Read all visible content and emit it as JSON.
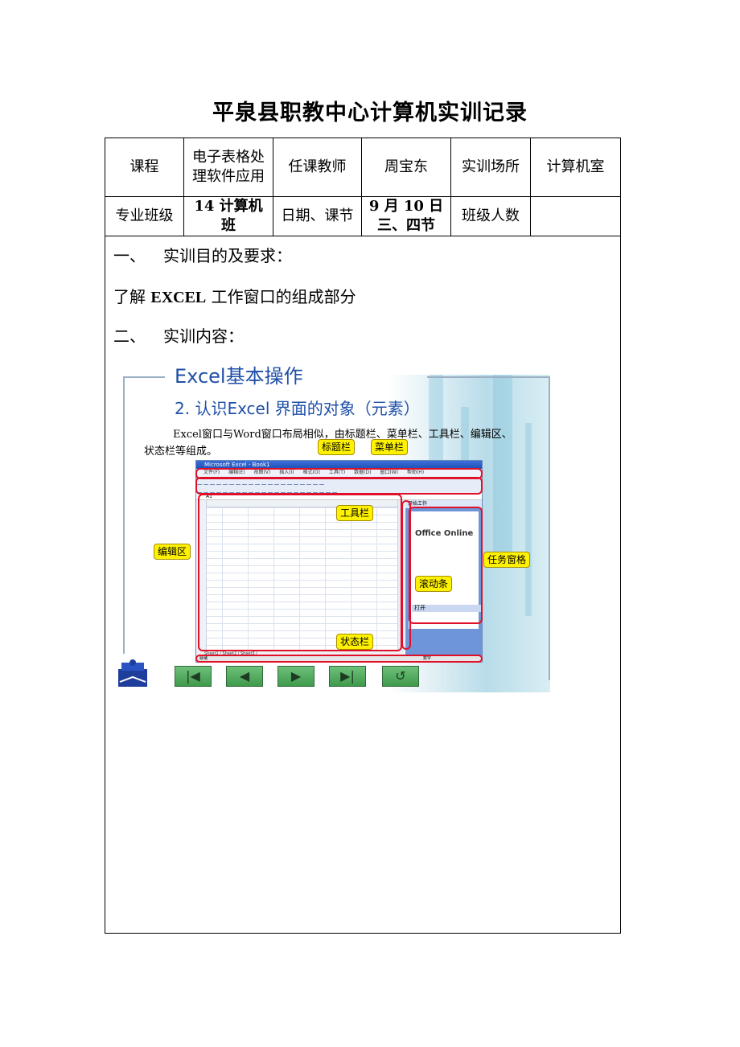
{
  "title": "平泉县职教中心计算机实训记录",
  "table": {
    "row1": [
      "课程",
      "电子表格处理软件应用",
      "任课教师",
      "周宝东",
      "实训场所",
      "计算机室"
    ],
    "row2": [
      "专业班级",
      "14 计算机班",
      "日期、课节",
      "9 月 10 日三、四节",
      "班级人数",
      ""
    ]
  },
  "sections": {
    "s1_num": "一、",
    "s1_title": "实训目的及要求：",
    "goal_prefix": "了解 ",
    "goal_bold": "EXCEL",
    "goal_suffix": " 工作窗口的组成部分",
    "s2_num": "二、",
    "s2_title": "实训内容："
  },
  "slide": {
    "heading": "Excel基本操作",
    "subheading": "2.  认识Excel 界面的对象（元素）",
    "paragraph": "Excel窗口与Word窗口布局相似，由标题栏、菜单栏、工具栏、编辑区、状态栏等组成。",
    "window_title": "Microsoft Excel - Book1",
    "menus": [
      "文件(F)",
      "编辑(E)",
      "视图(V)",
      "插入(I)",
      "格式(O)",
      "工具(T)",
      "数据(D)",
      "窗口(W)",
      "帮助(H)"
    ],
    "name_box": "A1",
    "sheet_tabs": "Sheet1 / Sheet2 / Sheet3 /",
    "task_pane_title": "开始工作",
    "task_pane_brand": "Office Online",
    "task_pane_open": "打开",
    "status_left": "就绪",
    "status_right": "数字",
    "callouts": {
      "title_bar": "标题栏",
      "menu_bar": "菜单栏",
      "toolbar": "工具栏",
      "edit_area": "编辑区",
      "task_pane": "任务窗格",
      "scroll_bar": "滚动条",
      "status_bar": "状态栏"
    },
    "nav_buttons": [
      "first-icon",
      "prev-icon",
      "next-icon",
      "last-icon",
      "return-icon"
    ]
  }
}
